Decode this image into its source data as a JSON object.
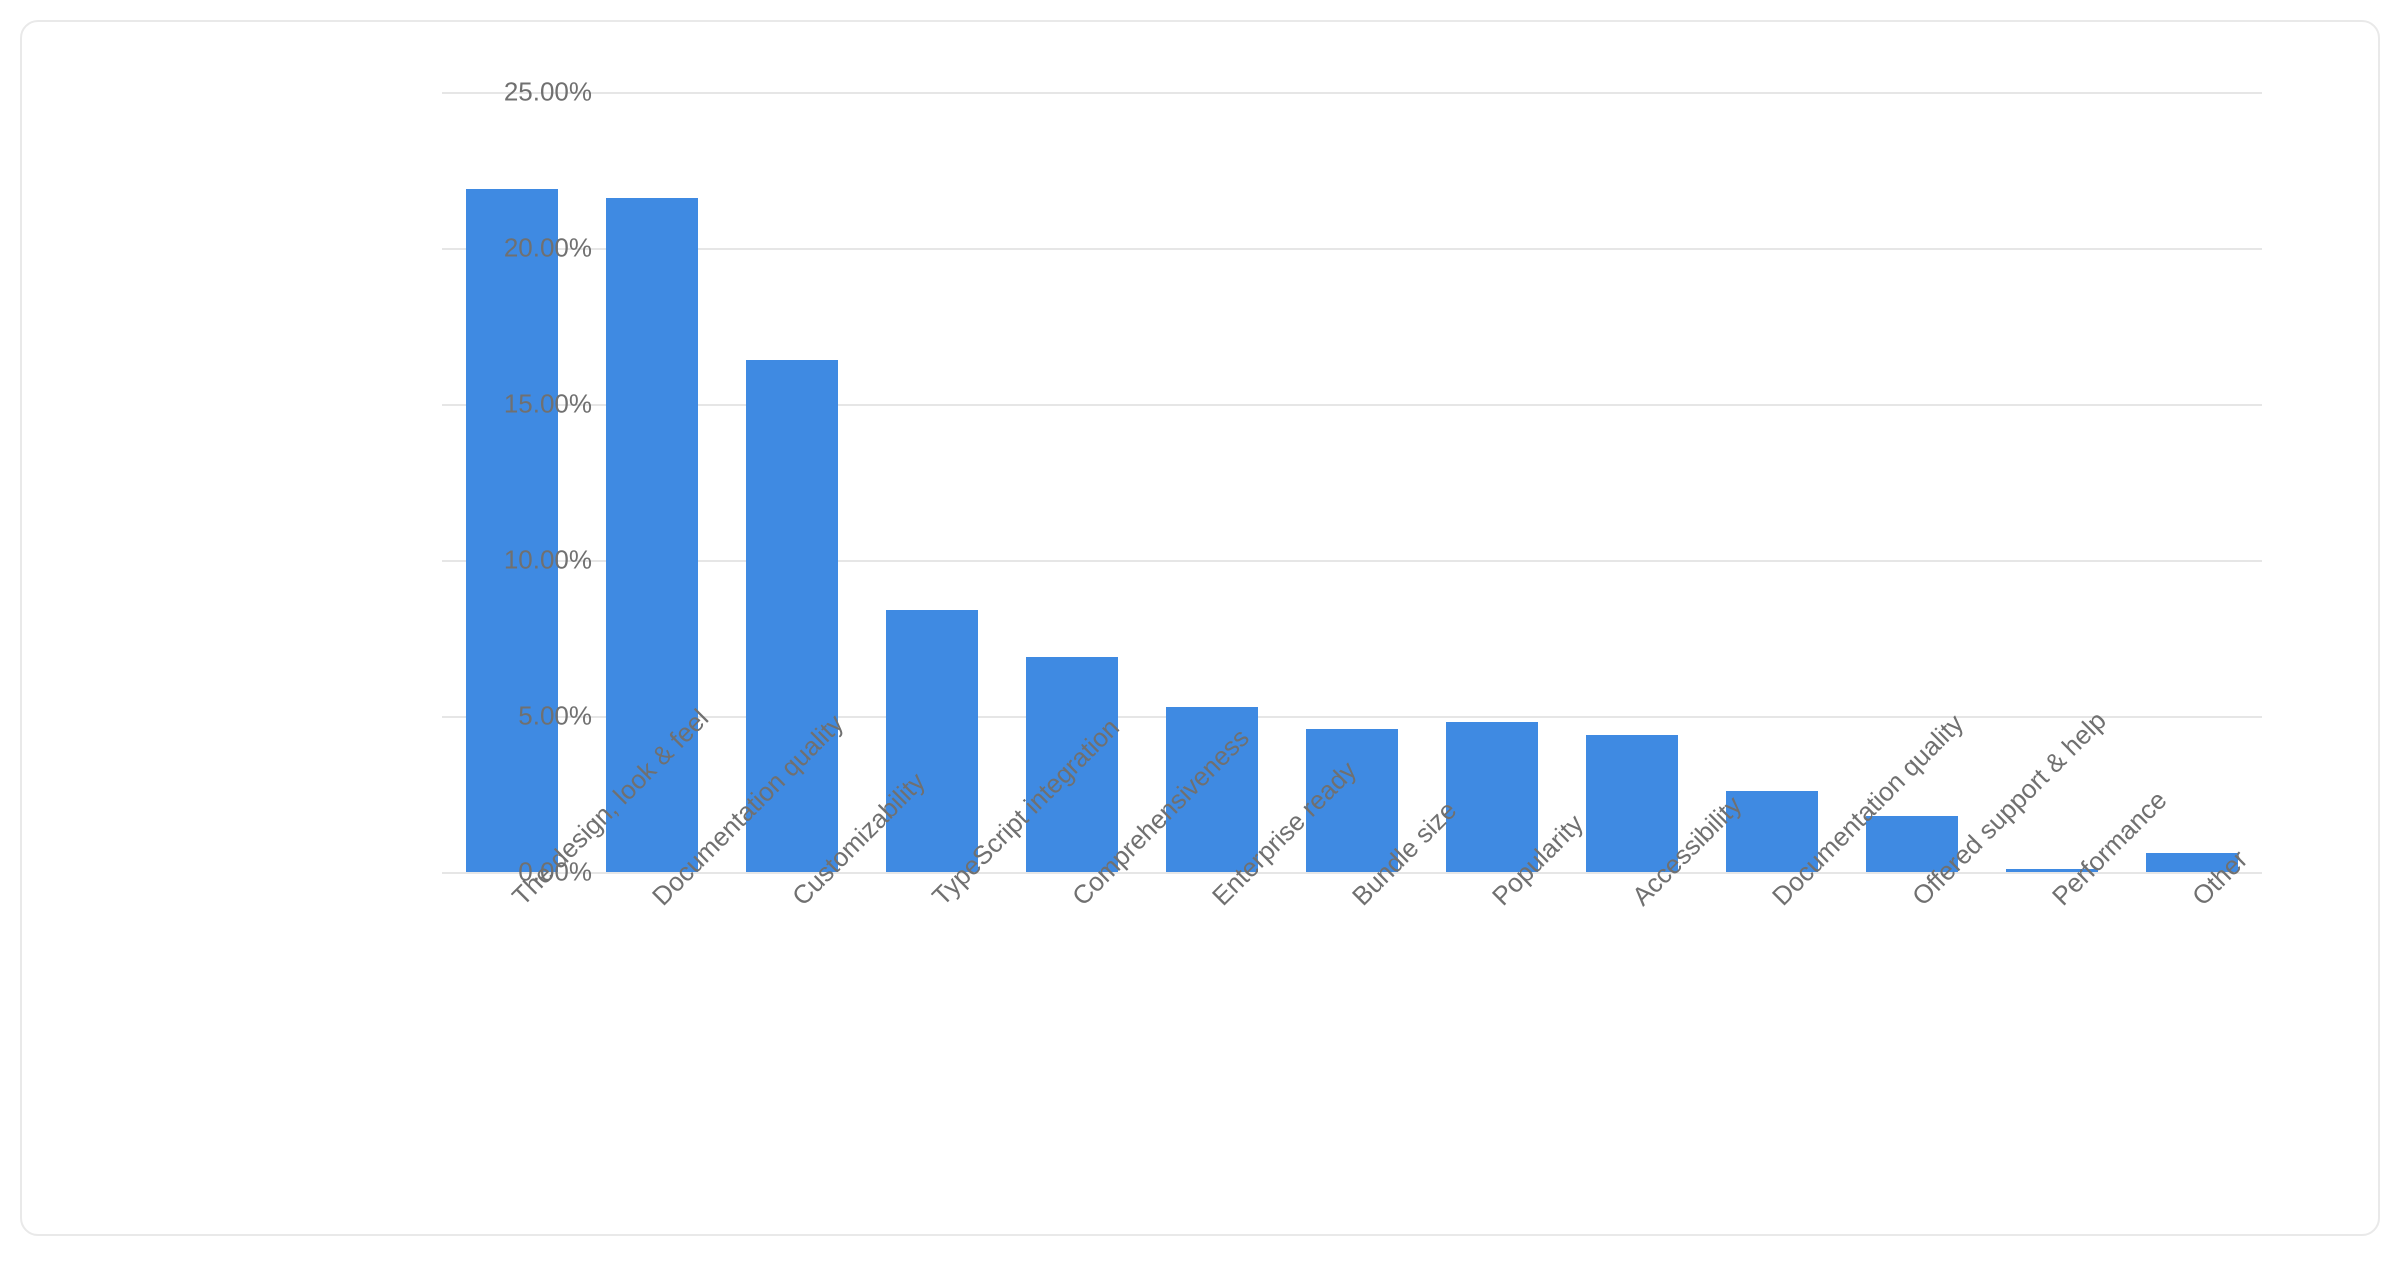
{
  "chart_data": {
    "type": "bar",
    "title": "",
    "xlabel": "",
    "ylabel": "",
    "ylim": [
      0,
      25
    ],
    "y_ticks": [
      0,
      5,
      10,
      15,
      20,
      25
    ],
    "y_tick_format": "percent_2dec",
    "grid": true,
    "legend": false,
    "categories": [
      "The design, look & feel",
      "Documentation quality",
      "Customizability",
      "TypeScript integration",
      "Comprehensiveness",
      "Enterprise ready",
      "Bundle size",
      "Popularity",
      "Accessibility",
      "Documentation quality",
      "Offered support & help",
      "Performance",
      "Other"
    ],
    "values": [
      21.9,
      21.6,
      16.4,
      8.4,
      6.9,
      5.3,
      4.6,
      4.8,
      4.4,
      2.6,
      1.8,
      0.1,
      0.6
    ],
    "bar_color": "#3f8ae2"
  }
}
